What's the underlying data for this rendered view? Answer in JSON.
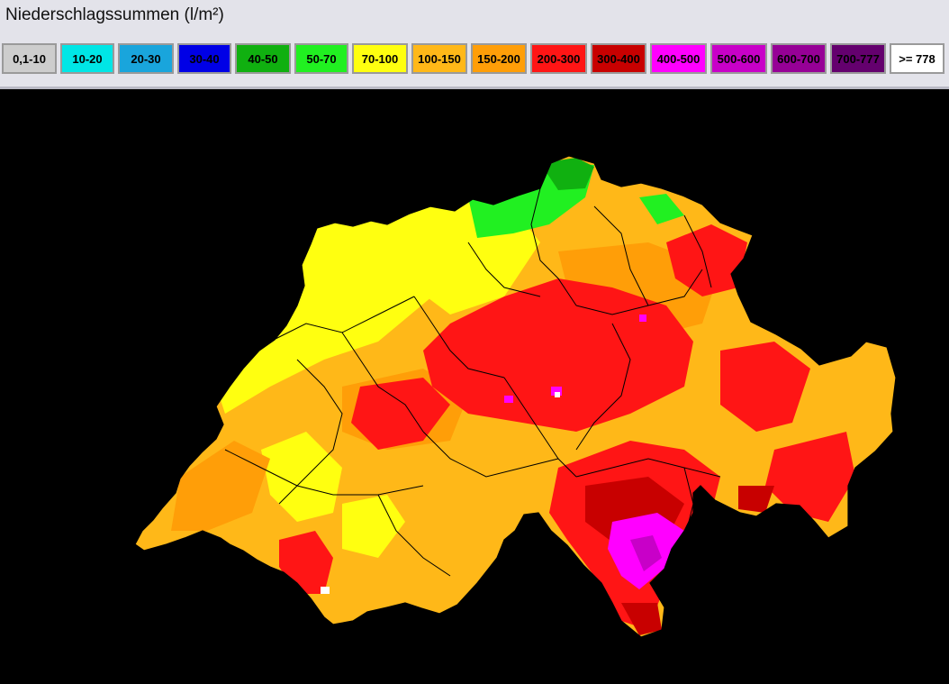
{
  "header": {
    "title": "Niederschlagssummen (l/m²)"
  },
  "legend": [
    {
      "label": "0,1-10",
      "color": "#cdcdcd",
      "text": "#000000"
    },
    {
      "label": "10-20",
      "color": "#00e6e6",
      "text": "#000000"
    },
    {
      "label": "20-30",
      "color": "#19a5dc",
      "text": "#000000"
    },
    {
      "label": "30-40",
      "color": "#0000e6",
      "text": "#000000"
    },
    {
      "label": "40-50",
      "color": "#10b010",
      "text": "#000000"
    },
    {
      "label": "50-70",
      "color": "#21f021",
      "text": "#000000"
    },
    {
      "label": "70-100",
      "color": "#ffff10",
      "text": "#000000"
    },
    {
      "label": "100-150",
      "color": "#ffb818",
      "text": "#000000"
    },
    {
      "label": "150-200",
      "color": "#ff9e08",
      "text": "#000000"
    },
    {
      "label": "200-300",
      "color": "#ff1515",
      "text": "#000000"
    },
    {
      "label": "300-400",
      "color": "#c80000",
      "text": "#000000"
    },
    {
      "label": "400-500",
      "color": "#ff00ff",
      "text": "#000000"
    },
    {
      "label": "500-600",
      "color": "#c800c8",
      "text": "#000000"
    },
    {
      "label": "600-700",
      "color": "#960096",
      "text": "#000000"
    },
    {
      "label": "700-777",
      "color": "#64006e",
      "text": "#000000"
    },
    {
      "label": ">= 778",
      "color": "#ffffff",
      "text": "#000000"
    }
  ],
  "map": {
    "background": "#000000",
    "region": "Switzerland",
    "border_color": "#000000"
  }
}
